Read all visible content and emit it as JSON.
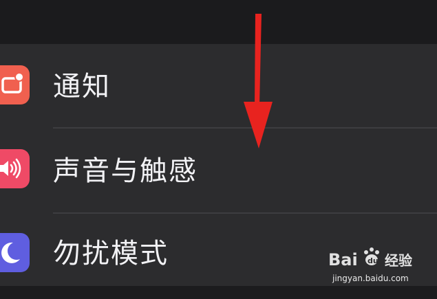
{
  "settings": {
    "items": [
      {
        "label": "通知",
        "icon": "notification-icon",
        "icon_color": "#f0604f"
      },
      {
        "label": "声音与触感",
        "icon": "speaker-icon",
        "icon_color": "#ef4a66"
      },
      {
        "label": "勿扰模式",
        "icon": "moon-icon",
        "icon_color": "#5f5ee0"
      }
    ]
  },
  "annotation": {
    "arrow_color": "#e8231f",
    "arrow_direction": "down"
  },
  "watermark": {
    "logo": "Baidu经验",
    "url": "jingyan.baidu.com"
  }
}
